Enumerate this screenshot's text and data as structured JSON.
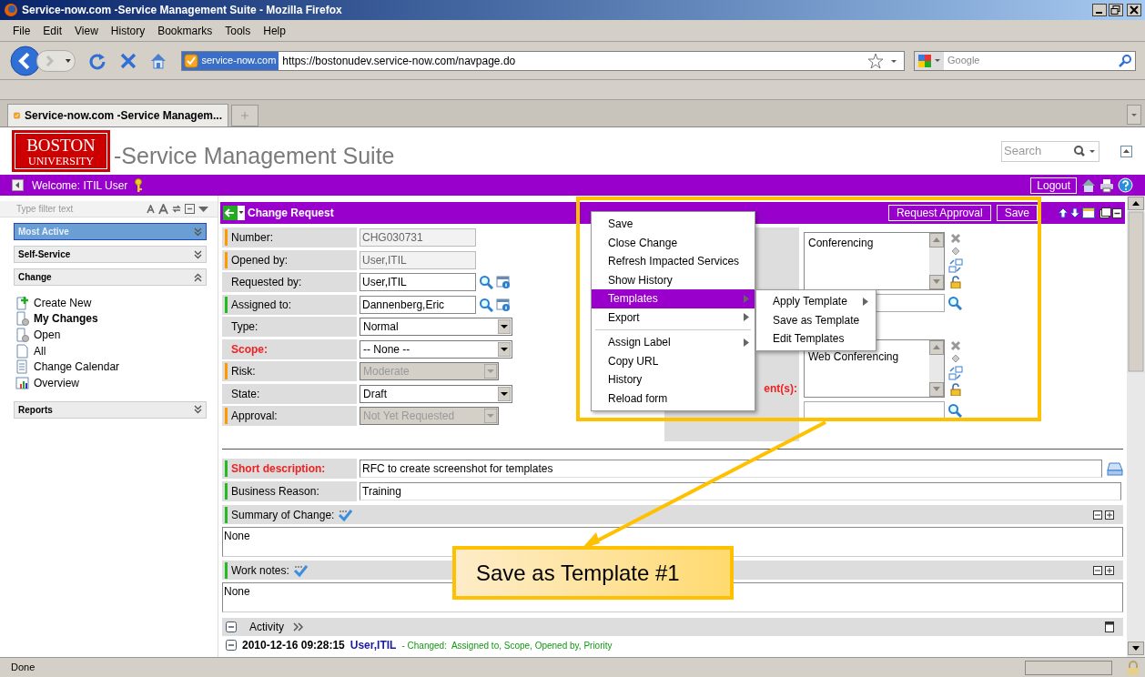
{
  "window": {
    "title": "Service-now.com -Service Management Suite - Mozilla Firefox"
  },
  "menu_bar": [
    "File",
    "Edit",
    "View",
    "History",
    "Bookmarks",
    "Tools",
    "Help"
  ],
  "address_bar": {
    "site_badge": "service-now.com",
    "url": "https://bostonudev.service-now.com/navpage.do"
  },
  "search_bar": {
    "placeholder": "Google"
  },
  "tabs": [
    {
      "label": "Service-now.com -Service Managem...",
      "selected": true
    }
  ],
  "header": {
    "logo_lines": [
      "BOSTON",
      "UNIVERSITY"
    ],
    "title": "-Service Management Suite",
    "search_placeholder": "Search"
  },
  "banner": {
    "welcome": "Welcome: ITIL User",
    "logout": "Logout"
  },
  "sidebar": {
    "filter_placeholder": "Type filter text",
    "sections": [
      {
        "label": "Most Active",
        "selected": true,
        "expanded": false
      },
      {
        "label": "Self-Service",
        "selected": false,
        "expanded": false
      },
      {
        "label": "Change",
        "selected": false,
        "expanded": true,
        "modules": [
          {
            "label": "Create New",
            "kind": "add",
            "selected": false
          },
          {
            "label": "My Changes",
            "kind": "filter",
            "selected": true
          },
          {
            "label": "Open",
            "kind": "filter",
            "selected": false
          },
          {
            "label": "All",
            "kind": "document",
            "selected": false
          },
          {
            "label": "Change Calendar",
            "kind": "calendar",
            "selected": false
          },
          {
            "label": "Overview",
            "kind": "chart",
            "selected": false
          }
        ]
      },
      {
        "label": "Reports",
        "selected": false,
        "expanded": false
      }
    ]
  },
  "form": {
    "title": "Change Request",
    "buttons": [
      "Request Approval",
      "Save"
    ],
    "fields": [
      {
        "label": "Number:",
        "value": "CHG030731",
        "kind": "readonly",
        "color": "#ff9900",
        "required": false
      },
      {
        "label": "Opened by:",
        "value": "User,ITIL",
        "kind": "readonly",
        "color": "#ff9900",
        "required": false
      },
      {
        "label": "Requested by:",
        "value": "User,ITIL",
        "kind": "reference",
        "required": false
      },
      {
        "label": "Assigned to:",
        "value": "Dannenberg,Eric",
        "kind": "reference",
        "color": "#22bb22",
        "required": false
      },
      {
        "label": "Type:",
        "value": "Normal",
        "kind": "select",
        "required": false
      },
      {
        "label": "Scope:",
        "value": "-- None --",
        "kind": "select",
        "required": true
      },
      {
        "label": "Risk:",
        "value": "Moderate",
        "kind": "disabled_select",
        "color": "#ff9900",
        "required": false
      },
      {
        "label": "State:",
        "value": "Draft",
        "kind": "select",
        "required": false
      },
      {
        "label": "Approval:",
        "value": "Not Yet Requested",
        "kind": "disabled_select",
        "color": "#ff9900",
        "required": false
      }
    ],
    "right_fields": [
      {
        "kind": "list",
        "value": "Conferencing"
      },
      {
        "kind": "reference"
      },
      {
        "kind": "list",
        "value": "Web Conferencing",
        "label": "ent(s):"
      },
      {
        "kind": "reference"
      }
    ],
    "wide_fields": [
      {
        "label": "Short description:",
        "value": "RFC to create screenshot for templates",
        "required": true,
        "color": "#22bb22"
      },
      {
        "label": "Business Reason:",
        "value": "Training",
        "required": false,
        "color": "#22bb22"
      }
    ],
    "journal_fields": [
      {
        "label": "Summary of Change:",
        "value": "None",
        "color": "#22bb22"
      },
      {
        "label": "Work notes:",
        "value": "None",
        "color": "#22bb22"
      }
    ],
    "activity": {
      "title": "Activity",
      "entries": [
        {
          "time": "2010-12-16 09:28:15",
          "user": "User,ITIL",
          "changes": "- Changed:  Assigned to, Scope, Opened by, Priority"
        }
      ]
    }
  },
  "context_menu": {
    "items": [
      {
        "kind": "item",
        "label": "Save",
        "has_submenu": false,
        "selected": false
      },
      {
        "kind": "item",
        "label": "Close Change",
        "has_submenu": false,
        "selected": false
      },
      {
        "kind": "item",
        "label": "Refresh Impacted Services",
        "has_submenu": false,
        "selected": false
      },
      {
        "kind": "item",
        "label": "Show History",
        "has_submenu": false,
        "selected": false
      },
      {
        "kind": "item",
        "label": "Templates",
        "has_submenu": true,
        "selected": true
      },
      {
        "kind": "item",
        "label": "Export",
        "has_submenu": true,
        "selected": false
      },
      {
        "kind": "separator"
      },
      {
        "kind": "item",
        "label": "Assign Label",
        "has_submenu": true,
        "selected": false
      },
      {
        "kind": "item",
        "label": "Copy URL",
        "has_submenu": false,
        "selected": false
      },
      {
        "kind": "item",
        "label": "History",
        "has_submenu": false,
        "selected": false
      },
      {
        "kind": "item",
        "label": "Reload form",
        "has_submenu": false,
        "selected": false
      }
    ],
    "submenu": [
      {
        "label": "Apply Template",
        "has_submenu": true
      },
      {
        "label": "Save as Template",
        "has_submenu": false
      },
      {
        "label": "Edit Templates",
        "has_submenu": false
      }
    ]
  },
  "callout": {
    "text": "Save as Template #1"
  },
  "status_bar": {
    "text": "Done"
  }
}
